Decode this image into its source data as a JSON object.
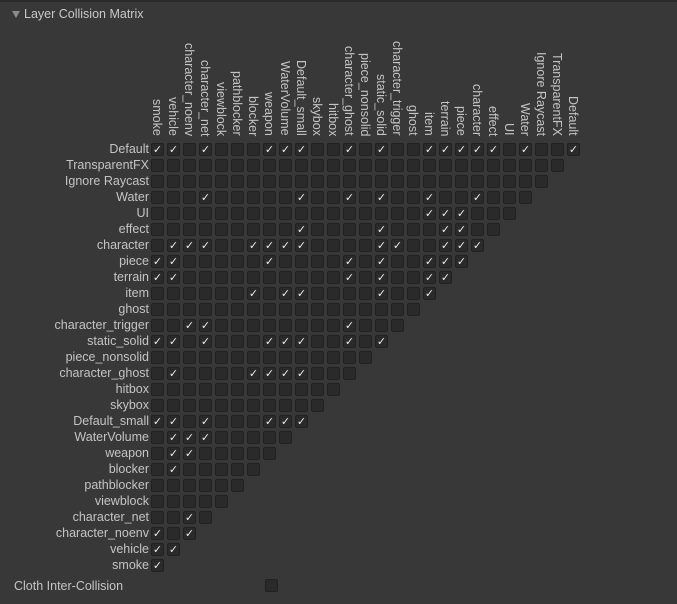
{
  "header": {
    "title": "Layer Collision Matrix",
    "expanded": true
  },
  "layers": [
    "Default",
    "TransparentFX",
    "Ignore Raycast",
    "Water",
    "UI",
    "effect",
    "character",
    "piece",
    "terrain",
    "item",
    "ghost",
    "character_trigger",
    "static_solid",
    "piece_nonsolid",
    "character_ghost",
    "hitbox",
    "skybox",
    "Default_small",
    "WaterVolume",
    "weapon",
    "blocker",
    "pathblocker",
    "viewblock",
    "character_net",
    "character_noenv",
    "vehicle",
    "smoke"
  ],
  "columns": [
    "smoke",
    "vehicle",
    "character_noenv",
    "character_net",
    "viewblock",
    "pathblocker",
    "blocker",
    "weapon",
    "WaterVolume",
    "Default_small",
    "skybox",
    "hitbox",
    "character_ghost",
    "piece_nonsolid",
    "static_solid",
    "character_trigger",
    "ghost",
    "item",
    "terrain",
    "piece",
    "character",
    "effect",
    "UI",
    "Water",
    "Ignore Raycast",
    "TransparentFX",
    "Default"
  ],
  "matrix": {
    "Default": [
      "smoke",
      "vehicle",
      "character_net",
      "weapon",
      "WaterVolume",
      "Default_small",
      "character_ghost",
      "static_solid",
      "item",
      "terrain",
      "piece",
      "character",
      "effect",
      "Water",
      "Default"
    ],
    "TransparentFX": [],
    "Ignore Raycast": [],
    "Water": [
      "character_net",
      "Default_small",
      "character_ghost",
      "static_solid",
      "item",
      "character"
    ],
    "UI": [
      "item",
      "terrain",
      "piece"
    ],
    "effect": [
      "Default_small",
      "static_solid",
      "terrain",
      "piece"
    ],
    "character": [
      "vehicle",
      "character_noenv",
      "character_net",
      "blocker",
      "weapon",
      "WaterVolume",
      "Default_small",
      "static_solid",
      "character_trigger",
      "terrain",
      "piece",
      "character"
    ],
    "piece": [
      "smoke",
      "vehicle",
      "weapon",
      "character_ghost",
      "static_solid",
      "item",
      "terrain",
      "piece"
    ],
    "terrain": [
      "smoke",
      "vehicle",
      "character_ghost",
      "static_solid",
      "item",
      "terrain"
    ],
    "item": [
      "blocker",
      "WaterVolume",
      "Default_small",
      "static_solid",
      "item"
    ],
    "ghost": [],
    "character_trigger": [
      "character_noenv",
      "character_net",
      "character_ghost"
    ],
    "static_solid": [
      "smoke",
      "vehicle",
      "character_net",
      "weapon",
      "WaterVolume",
      "Default_small",
      "character_ghost",
      "static_solid"
    ],
    "piece_nonsolid": [],
    "character_ghost": [
      "vehicle",
      "blocker",
      "weapon",
      "WaterVolume",
      "Default_small"
    ],
    "hitbox": [],
    "skybox": [],
    "Default_small": [
      "smoke",
      "vehicle",
      "character_net",
      "weapon",
      "WaterVolume",
      "Default_small"
    ],
    "WaterVolume": [
      "vehicle",
      "character_noenv",
      "character_net"
    ],
    "weapon": [
      "vehicle",
      "character_noenv"
    ],
    "blocker": [
      "vehicle"
    ],
    "pathblocker": [],
    "viewblock": [],
    "character_net": [
      "character_noenv"
    ],
    "character_noenv": [
      "smoke",
      "character_noenv"
    ],
    "vehicle": [
      "smoke",
      "vehicle"
    ],
    "smoke": [
      "smoke"
    ]
  },
  "cloth": {
    "label": "Cloth Inter-Collision",
    "checked": false
  },
  "icons": {
    "check": "✓",
    "foldout": "triangle-down"
  }
}
